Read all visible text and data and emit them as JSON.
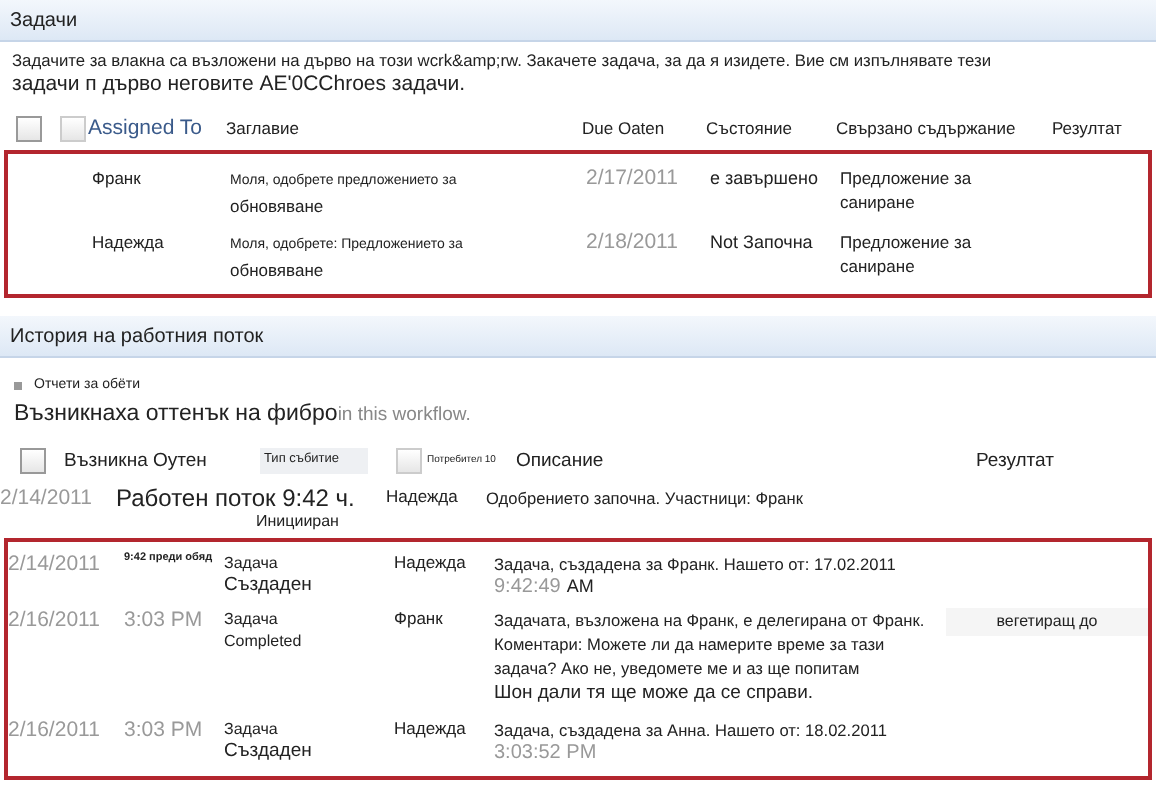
{
  "tasks": {
    "title": "Задачи",
    "intro_line1": "Задачите за влакна са възложени на дърво на този wcrk&amp;rw. Закачете задача, за да я изидете. Вие см изпълнявате тези",
    "intro_line2": "задачи п дърво неговите AE'0CChroes задачи.",
    "checkboxes": [
      {
        "checked": false
      },
      {
        "checked": false
      }
    ],
    "columns": [
      {
        "label": "Assigned To",
        "kind": "link"
      },
      {
        "label": "Заглавие",
        "kind": "plain"
      },
      {
        "label": "Due Oaten",
        "kind": "plain"
      },
      {
        "label": "Състояние",
        "kind": "plain"
      },
      {
        "label": "Свързано съдържание",
        "kind": "plain"
      },
      {
        "label": "Резултат",
        "kind": "plain"
      }
    ],
    "rows": [
      {
        "assigned_to": "Франк",
        "title": "Моля, одобрете предложението за",
        "title_line2": "обновяване",
        "due": "2/17/2011",
        "status": "е завършено",
        "related": "Предложение за саниране"
      },
      {
        "assigned_to": "Надежда",
        "title": "Моля, одобрете: Предложението за",
        "title_line2": "обновяване",
        "due": "2/18/2011",
        "status": "Not Започна",
        "related": "Предложение за саниране"
      }
    ]
  },
  "history": {
    "title": "История на работния поток",
    "filter": "Отчети за обёти",
    "heading": "Възникнаха оттенък на фибро",
    "heading_suffix": "in this workflow.",
    "checkboxes": [
      {
        "checked": false
      },
      {
        "checked": false
      }
    ],
    "columns": {
      "occurred": "Възникна Оутен",
      "event_type": "Тип събитие",
      "user": "Потребител 10",
      "description": "Описание",
      "outcome": "Резултат"
    },
    "rows": [
      {
        "kind": "plain",
        "date": "2/14/2011",
        "event": "Работен поток 9:42 ч.",
        "event_line2": "Иницииран",
        "user": "Надежда",
        "description": "Одобрението започна. Участници: Франк"
      },
      {
        "kind": "boxed",
        "date": "2/14/2011",
        "time": "9:42 преди обяд",
        "event": "Задача",
        "event_line2": "Създаден",
        "user": "Надежда",
        "description": "Задача, създадена за Франк. Нашето от: 17.02.2011",
        "description_time": "9:42:49",
        "description_suffix": "AM"
      },
      {
        "kind": "boxed",
        "date": "2/16/2011",
        "time": "3:03 PM",
        "event": "Задача",
        "event_line2": "Completed",
        "user": "Франк",
        "description": "Задачата, възложена на Франк, е делегирана от Франк. Коментари: Можете ли да намерите време за тази задача? Ако не, уведомете ме и аз ще попитам",
        "description_line2": "Шон дали тя ще може да се справи.",
        "outcome": "вегетиращ до"
      },
      {
        "kind": "boxed",
        "date": "2/16/2011",
        "time": "3:03 PM",
        "event": "Задача",
        "event_line2": "Създаден",
        "user": "Надежда",
        "description": "Задача, създадена за Анна. Нашето от: 18.02.2011",
        "description_time": "3:03:52 PM"
      }
    ]
  }
}
